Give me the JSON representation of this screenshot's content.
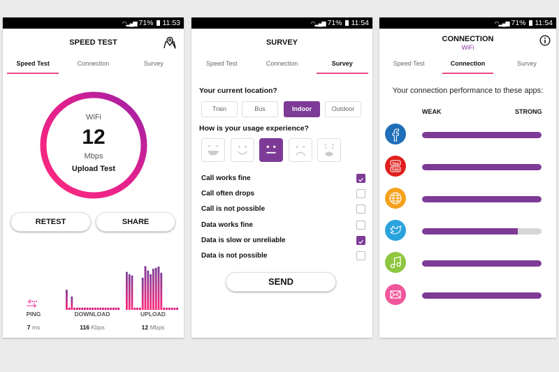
{
  "colors": {
    "accent_purple": "#7d3a96",
    "accent_pink": "#e84a8a",
    "tab_underline": "#e84a8a"
  },
  "screens": [
    {
      "status": {
        "battery": "71%",
        "time": "11:53"
      },
      "title": "SPEED TEST",
      "action_icon": "map-pin-icon",
      "tabs": [
        {
          "label": "Speed Test",
          "active": true
        },
        {
          "label": "Connection",
          "active": false
        },
        {
          "label": "Survey",
          "active": false
        }
      ],
      "gauge": {
        "network": "WiFi",
        "value": "12",
        "unit": "Mbps",
        "test": "Upload Test"
      },
      "buttons": {
        "retest": "RETEST",
        "share": "SHARE"
      },
      "metrics": [
        {
          "label": "PING",
          "value": "7",
          "unit": "ms",
          "icon": "ping-arrows-icon"
        },
        {
          "label": "DOWNLOAD",
          "value": "116",
          "unit": "Kbps"
        },
        {
          "label": "UPLOAD",
          "value": "12",
          "unit": "Mbps"
        }
      ],
      "download_samples": [
        0.45,
        0.05,
        0.3,
        0.05,
        0.05,
        0.05,
        0.05,
        0.05,
        0.05,
        0.05,
        0.05,
        0.05,
        0.05,
        0.05,
        0.05,
        0.05,
        0.05,
        0.05,
        0.05,
        0.05,
        0.05
      ],
      "upload_samples": [
        0.85,
        0.8,
        0.77,
        0.05,
        0.05,
        0.05,
        0.72,
        0.98,
        0.88,
        0.8,
        0.92,
        0.94,
        0.97,
        0.83,
        0.05,
        0.05,
        0.05,
        0.05,
        0.05,
        0.05
      ]
    },
    {
      "status": {
        "battery": "71%",
        "time": "11:54"
      },
      "title": "SURVEY",
      "tabs": [
        {
          "label": "Speed Test",
          "active": false
        },
        {
          "label": "Connection",
          "active": false
        },
        {
          "label": "Survey",
          "active": true
        }
      ],
      "location_question": "Your current location?",
      "locations": [
        {
          "label": "Train",
          "selected": false
        },
        {
          "label": "Bus",
          "selected": false
        },
        {
          "label": "Indoor",
          "selected": true
        },
        {
          "label": "Outdoor",
          "selected": false
        }
      ],
      "experience_question": "How is your usage experience?",
      "faces": [
        {
          "name": "very-happy-face-icon",
          "selected": false
        },
        {
          "name": "happy-face-icon",
          "selected": false
        },
        {
          "name": "neutral-face-icon",
          "selected": true
        },
        {
          "name": "sad-face-icon",
          "selected": false
        },
        {
          "name": "shocked-face-icon",
          "selected": false
        }
      ],
      "options": [
        {
          "label": "Call works fine",
          "checked": true
        },
        {
          "label": "Call often drops",
          "checked": false
        },
        {
          "label": "Call is not possible",
          "checked": false
        },
        {
          "label": "Data works fine",
          "checked": false
        },
        {
          "label": "Data is slow or unreliable",
          "checked": true
        },
        {
          "label": "Data is not possible",
          "checked": false
        }
      ],
      "send": "SEND"
    },
    {
      "status": {
        "battery": "71%",
        "time": "11:54"
      },
      "title": "CONNECTION",
      "subtitle": "WiFi",
      "action_icon": "info-icon",
      "tabs": [
        {
          "label": "Speed Test",
          "active": false
        },
        {
          "label": "Connection",
          "active": true
        },
        {
          "label": "Survey",
          "active": false
        }
      ],
      "intro": "Your connection performance to these apps:",
      "scale": {
        "weak": "WEAK",
        "strong": "STRONG"
      },
      "apps": [
        {
          "name": "facebook",
          "icon": "facebook-icon",
          "color": "#1f6fb8",
          "strength": 1.0
        },
        {
          "name": "youtube",
          "icon": "youtube-icon",
          "color": "#e0201e",
          "strength": 1.0
        },
        {
          "name": "web",
          "icon": "globe-icon",
          "color": "#f5a11c",
          "strength": 1.0
        },
        {
          "name": "twitter",
          "icon": "twitter-icon",
          "color": "#2aa3dd",
          "strength": 0.8
        },
        {
          "name": "music",
          "icon": "music-note-icon",
          "color": "#8dc63f",
          "strength": 1.0
        },
        {
          "name": "email",
          "icon": "mail-icon",
          "color": "#f0579a",
          "strength": 1.0
        }
      ]
    }
  ]
}
